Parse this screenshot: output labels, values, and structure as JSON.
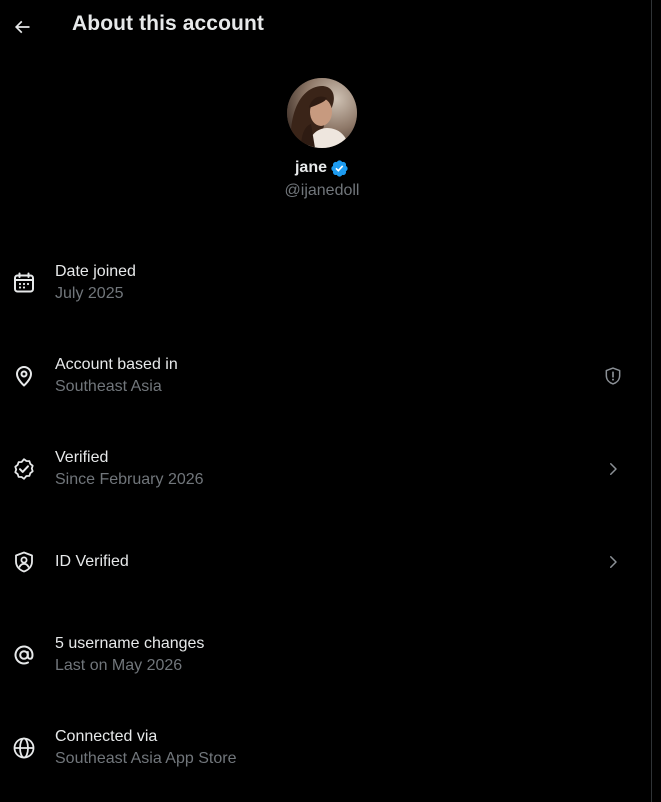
{
  "header": {
    "title": "About this account",
    "back_icon": "arrow-left-icon"
  },
  "profile": {
    "display_name": "jane",
    "handle": "@ijanedoll",
    "verified_badge_color": "#1d9bf0",
    "avatar_icon": "profile-photo"
  },
  "rows": [
    {
      "label": "Date joined",
      "sub": "July 2025",
      "icon": "calendar-icon"
    },
    {
      "label": "Account based in",
      "sub": "Southeast Asia",
      "icon": "location-pin-icon",
      "right_icon": "shield-alert-icon"
    },
    {
      "label": "Verified",
      "sub": "Since February 2026",
      "icon": "verified-check-icon",
      "right_icon": "chevron-right-icon"
    },
    {
      "label": "ID Verified",
      "sub": "",
      "icon": "id-shield-icon",
      "right_icon": "chevron-right-icon"
    },
    {
      "label": "5 username changes",
      "sub": "Last on May 2026",
      "icon": "at-sign-icon"
    },
    {
      "label": "Connected via",
      "sub": "Southeast Asia App Store",
      "icon": "globe-icon"
    }
  ],
  "colors": {
    "background": "#000000",
    "primary_text": "#e7e9ea",
    "secondary_text": "#71767b",
    "accent": "#1d9bf0"
  }
}
